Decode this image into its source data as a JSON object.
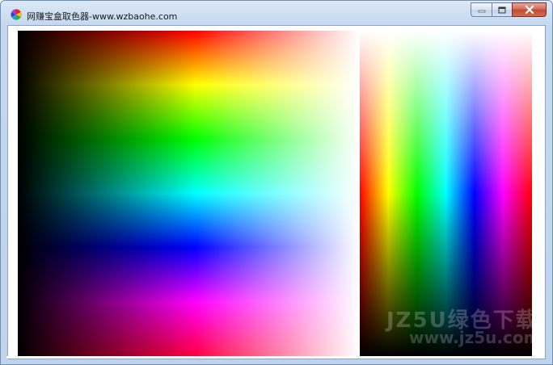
{
  "window": {
    "title": "网赚宝盒取色器-www.wzbaohe.com",
    "app_icon": "color-wheel-icon"
  },
  "caption_buttons": {
    "minimize_icon": "minimize-icon",
    "maximize_icon": "maximize-icon",
    "close_icon": "close-icon"
  },
  "watermark": {
    "line1": "JZ5U绿色下载",
    "line2": "www.jz5u.com"
  }
}
